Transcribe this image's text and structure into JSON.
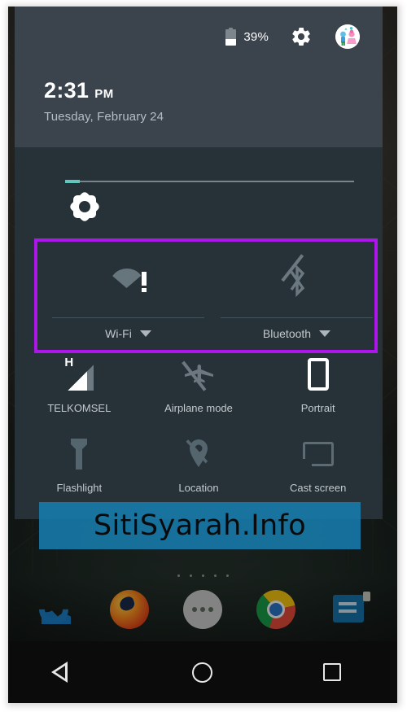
{
  "status_bar": {
    "battery_percent": "39%",
    "battery_icon": "battery-icon",
    "settings_icon": "gear-icon",
    "avatar_icon": "user-avatar"
  },
  "clock": {
    "time": "2:31",
    "ampm": "PM",
    "date": "Tuesday, February 24"
  },
  "brightness": {
    "icon": "brightness-sun-icon",
    "value_percent": 4
  },
  "highlight": {
    "color": "#ac16e8",
    "note": "purple selection box around Wi-Fi and Bluetooth tiles"
  },
  "tiles_row_highlighted": [
    {
      "label": "Wi-Fi",
      "icon": "wifi-no-internet-icon",
      "has_caret": true,
      "state": "warning"
    },
    {
      "label": "Bluetooth",
      "icon": "bluetooth-disabled-icon",
      "has_caret": true,
      "state": "off"
    }
  ],
  "tiles_row_2": [
    {
      "label": "TELKOMSEL",
      "icon": "cellular-signal-icon",
      "badge": "H"
    },
    {
      "label": "Airplane mode",
      "icon": "airplane-off-icon"
    },
    {
      "label": "Portrait",
      "icon": "screen-rotation-portrait-icon"
    }
  ],
  "tiles_row_3": [
    {
      "label": "Flashlight",
      "icon": "flashlight-icon"
    },
    {
      "label": "Location",
      "icon": "location-off-icon"
    },
    {
      "label": "Cast screen",
      "icon": "cast-screen-icon"
    }
  ],
  "watermark": {
    "text": "SitiSyarah.Info",
    "background_color": "#167eb0"
  },
  "dock": [
    {
      "label": "Phone",
      "icon": "phone-icon"
    },
    {
      "label": "Firefox",
      "icon": "firefox-icon"
    },
    {
      "label": "All apps",
      "icon": "app-drawer-icon"
    },
    {
      "label": "Chrome",
      "icon": "chrome-icon"
    },
    {
      "label": "News",
      "icon": "news-app-icon"
    }
  ],
  "nav_bar": [
    {
      "label": "Back",
      "icon": "back-triangle-icon"
    },
    {
      "label": "Home",
      "icon": "home-circle-icon"
    },
    {
      "label": "Recents",
      "icon": "recents-square-icon"
    }
  ],
  "theme": {
    "shade_header_bg": "#3b434d",
    "shade_body_bg": "#263238",
    "accent_slider": "#62c6bf",
    "label_color": "#c3c9cd"
  }
}
